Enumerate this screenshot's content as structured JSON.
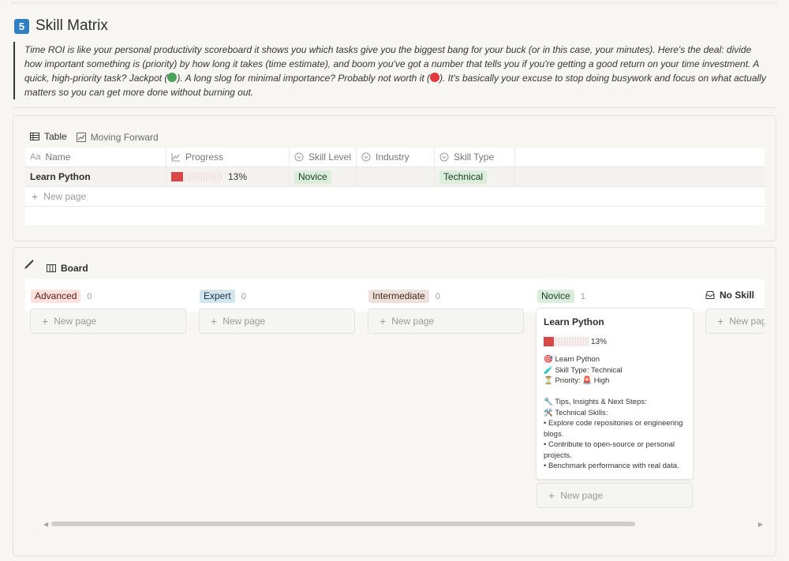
{
  "section": {
    "number": "5",
    "title": "Skill Matrix",
    "quote_parts": [
      "Time ROI is like your personal productivity scoreboard it shows you which tasks give you the biggest bang for your buck (or in this case, your minutes). Here's the deal: divide how important something is (priority) by how long it takes (time estimate), and boom you've got a number that tells you if you're getting a good return on your time investment. A quick, high-priority task? Jackpot (",
      "). A long slog for minimal importance? Probably not worth it (",
      "). It's basically your excuse to stop doing busywork and focus on what actually matters so you can get more done without burning out."
    ]
  },
  "table_view": {
    "tabs": [
      {
        "label": "Table",
        "icon": "table-icon"
      },
      {
        "label": "Moving Forward",
        "icon": "chart-icon"
      }
    ],
    "columns": [
      {
        "label": "Name",
        "icon": "text-aa-icon"
      },
      {
        "label": "Progress",
        "icon": "trend-icon"
      },
      {
        "label": "Skill Level",
        "icon": "select-icon"
      },
      {
        "label": "Industry",
        "icon": "select-icon"
      },
      {
        "label": "Skill Type",
        "icon": "select-icon"
      }
    ],
    "rows": [
      {
        "name": "Learn Python",
        "progress_label": "13%",
        "progress": 0.13,
        "skill_level": "Novice",
        "industry": "",
        "skill_type": "Technical"
      }
    ],
    "new_page": "New page"
  },
  "board_view": {
    "tab": "Board",
    "groups": [
      {
        "label": "Advanced",
        "count": "0",
        "color": "#ffe2dd"
      },
      {
        "label": "Expert",
        "count": "0",
        "color": "#d3e5ef"
      },
      {
        "label": "Intermediate",
        "count": "0",
        "color": "#eee0da"
      },
      {
        "label": "Novice",
        "count": "1",
        "color": "#dbeddb"
      }
    ],
    "no_skill_label": "No Skill",
    "new_page": "New page",
    "card": {
      "title": "Learn Python",
      "progress_label": "13%",
      "progress": 0.13,
      "body": "🎯 Learn Python\n🧪 Skill Type: Technical\n⏳ Priority: 🚨 High\n\n🔧 Tips, Insights & Next Steps:\n🛠️ Technical Skills:\n• Explore code repositories or engineering\nblogs.\n• Contribute to open-source or personal\nprojects.\n• Benchmark performance with real data."
    }
  }
}
